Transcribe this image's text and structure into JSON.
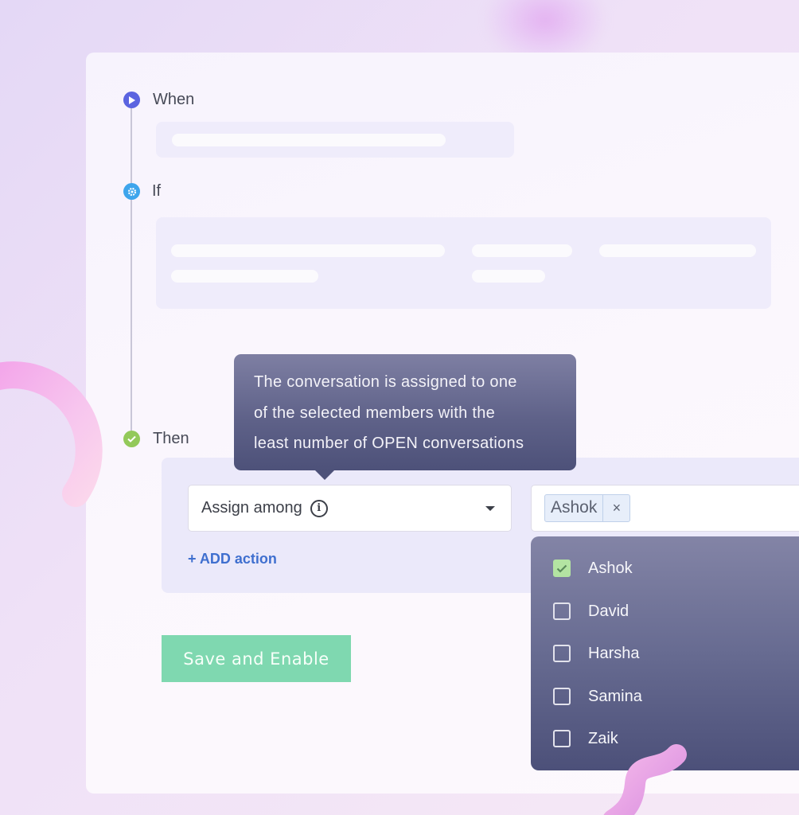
{
  "steps": {
    "when": {
      "label": "When",
      "icon": "play-icon",
      "color": "#5b64e0"
    },
    "if": {
      "label": "If",
      "icon": "gear-icon",
      "color": "#3ea5ec"
    },
    "then": {
      "label": "Then",
      "icon": "check-icon",
      "color": "#93c95a"
    }
  },
  "tooltip": {
    "lines": [
      "The conversation is assigned to one",
      "of the selected members with the",
      "least number of OPEN conversations"
    ]
  },
  "action": {
    "select_value": "Assign among",
    "add_action_label": "+ ADD action"
  },
  "members": {
    "selected_chips": [
      "Ashok"
    ],
    "chip_remove_symbol": "×",
    "options": [
      {
        "label": "Ashok",
        "checked": true
      },
      {
        "label": "David",
        "checked": false
      },
      {
        "label": "Harsha",
        "checked": false
      },
      {
        "label": "Samina",
        "checked": false
      },
      {
        "label": "Zaik",
        "checked": false
      }
    ]
  },
  "buttons": {
    "save_label": "Save and Enable",
    "save_color": "#7fd8b0"
  }
}
